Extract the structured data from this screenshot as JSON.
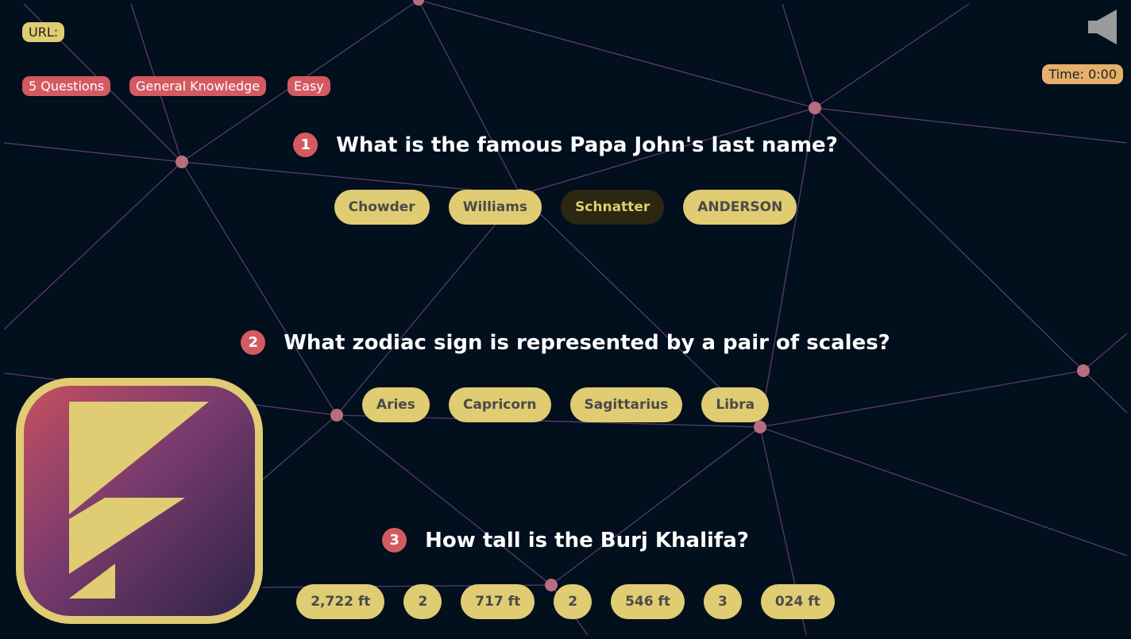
{
  "header": {
    "url_label": "URL:",
    "tags": [
      "5 Questions",
      "General Knowledge",
      "Easy"
    ],
    "timer": "Time: 0:00"
  },
  "icons": {
    "sound": "speaker-muted-icon",
    "logo": "app-logo"
  },
  "colors": {
    "background": "#020f1d",
    "accent_yellow": "#e0cc72",
    "accent_red": "#d45a61",
    "timer_orange": "#e6b06c",
    "network_line": "#5b3a6e",
    "network_node": "#b86d7e",
    "selected_option_bg": "#2b2712"
  },
  "questions": [
    {
      "number": "1",
      "text": "What is the famous Papa John's last name?",
      "options": [
        "Chowder",
        "Williams",
        "Schnatter",
        "ANDERSON"
      ],
      "selected": 2
    },
    {
      "number": "2",
      "text": "What zodiac sign is represented by a pair of scales?",
      "options": [
        "Aries",
        "Capricorn",
        "Sagittarius",
        "Libra"
      ],
      "selected": null
    },
    {
      "number": "3",
      "text": "How tall is the Burj Khalifa?",
      "options": [
        "2,722 ft",
        "2",
        "717 ft",
        "2",
        "546 ft",
        "3",
        "024 ft"
      ],
      "selected": null
    }
  ]
}
